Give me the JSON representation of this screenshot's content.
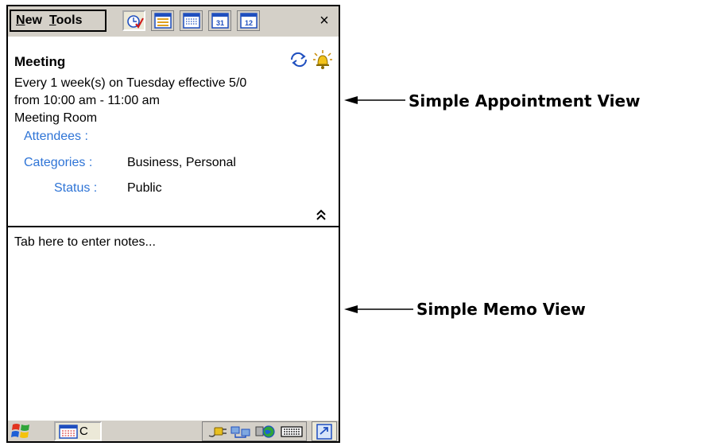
{
  "toolbar": {
    "menu_new": "New",
    "menu_tools": "Tools",
    "view_buttons": [
      "agenda-view-icon",
      "day-view-icon",
      "week-view-icon",
      "month-view-icon",
      "year-view-icon"
    ],
    "month_icon_number": "31",
    "year_icon_number": "12",
    "close_label": "×"
  },
  "appointment": {
    "title": "Meeting",
    "recurrence": " Every 1 week(s) on Tuesday effective  5/0",
    "time": "from 10:00 am - 11:00 am",
    "location": "Meeting Room",
    "attendees_label": "Attendees :",
    "categories_label": "Categories :",
    "categories_value": "Business, Personal",
    "status_label": "Status :",
    "status_value": "Public",
    "icons": [
      "recurring-icon",
      "reminder-alarm-icon",
      "collapse-chevron-icon"
    ]
  },
  "memo": {
    "placeholder": "Tab here to enter notes..."
  },
  "taskbar": {
    "task_label": "C",
    "tray_icons": [
      "power-plug-icon",
      "network-icon",
      "internet-globe-icon",
      "keyboard-icon"
    ]
  },
  "annotations": {
    "appointment_view": "Simple Appointment View",
    "memo_view": "Simple Memo View"
  },
  "colors": {
    "field_label": "#2e74d6",
    "chrome": "#d4d0c8"
  }
}
